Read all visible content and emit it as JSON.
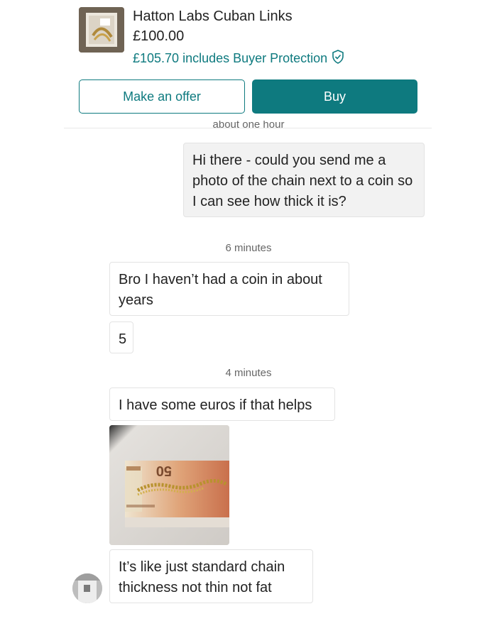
{
  "listing": {
    "title": "Hatton Labs Cuban Links",
    "price": "£100.00",
    "protection_text": "£105.70 includes Buyer Protection",
    "offer_button": "Make an offer",
    "buy_button": "Buy",
    "protection_icon": "shield-check-icon",
    "accent_color": "#0e7a7f"
  },
  "conversation": {
    "truncated_timestamp": "about one hour",
    "messages": [
      {
        "direction": "outgoing",
        "text": "Hi there - could you send me a photo of the chain next to a coin so I can see how thick it is?"
      },
      {
        "timestamp": "6 minutes"
      },
      {
        "direction": "incoming",
        "text": "Bro I haven’t had a coin in about years"
      },
      {
        "direction": "incoming",
        "text": "5"
      },
      {
        "timestamp": "4 minutes"
      },
      {
        "direction": "incoming",
        "text": "I have some euros if that helps"
      },
      {
        "direction": "incoming",
        "type": "photo",
        "banknote_text": "50"
      },
      {
        "direction": "incoming",
        "text": "It’s like just standard chain thickness not thin not fat"
      }
    ]
  }
}
